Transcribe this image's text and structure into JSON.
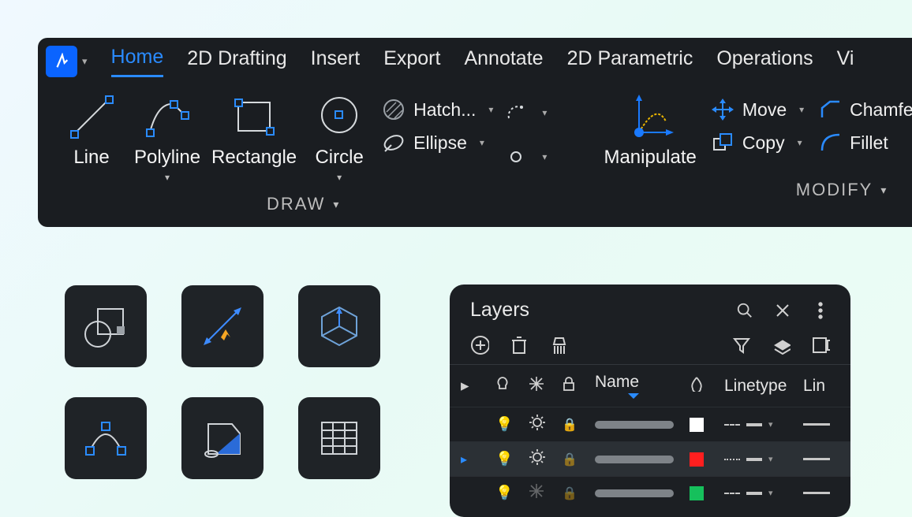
{
  "menu": {
    "items": [
      "Home",
      "2D Drafting",
      "Insert",
      "Export",
      "Annotate",
      "2D Parametric",
      "Operations",
      "Vi"
    ],
    "active": 0
  },
  "ribbon": {
    "draw": {
      "section_label": "DRAW",
      "tools": [
        {
          "label": "Line"
        },
        {
          "label": "Polyline",
          "dropdown": true
        },
        {
          "label": "Rectangle"
        },
        {
          "label": "Circle",
          "dropdown": true
        }
      ],
      "subtools": [
        {
          "label": "Hatch..."
        },
        {
          "label": "Ellipse"
        }
      ]
    },
    "modify": {
      "section_label": "MODIFY",
      "manipulate": "Manipulate",
      "subtools": [
        {
          "label": "Move"
        },
        {
          "label": "Copy"
        },
        {
          "label": "Chamfer"
        },
        {
          "label": "Fillet"
        }
      ]
    }
  },
  "layers_panel": {
    "title": "Layers",
    "columns": [
      "",
      "",
      "",
      "",
      "Name",
      "",
      "Linetype",
      "Lin"
    ],
    "rows": [
      {
        "visible": true,
        "frozen": false,
        "locked": true,
        "selected": false,
        "swatch": "#ffffff"
      },
      {
        "visible": true,
        "frozen": false,
        "locked": true,
        "selected": true,
        "swatch": "#ff1f1f"
      },
      {
        "visible": true,
        "frozen": true,
        "locked": true,
        "selected": false,
        "swatch": "#16c05c"
      }
    ]
  },
  "tile_icons": [
    "shape-combine-icon",
    "dimension-arrow-icon",
    "cube-3d-icon",
    "arc-polyline-icon",
    "sheet-fill-icon",
    "table-grid-icon"
  ]
}
